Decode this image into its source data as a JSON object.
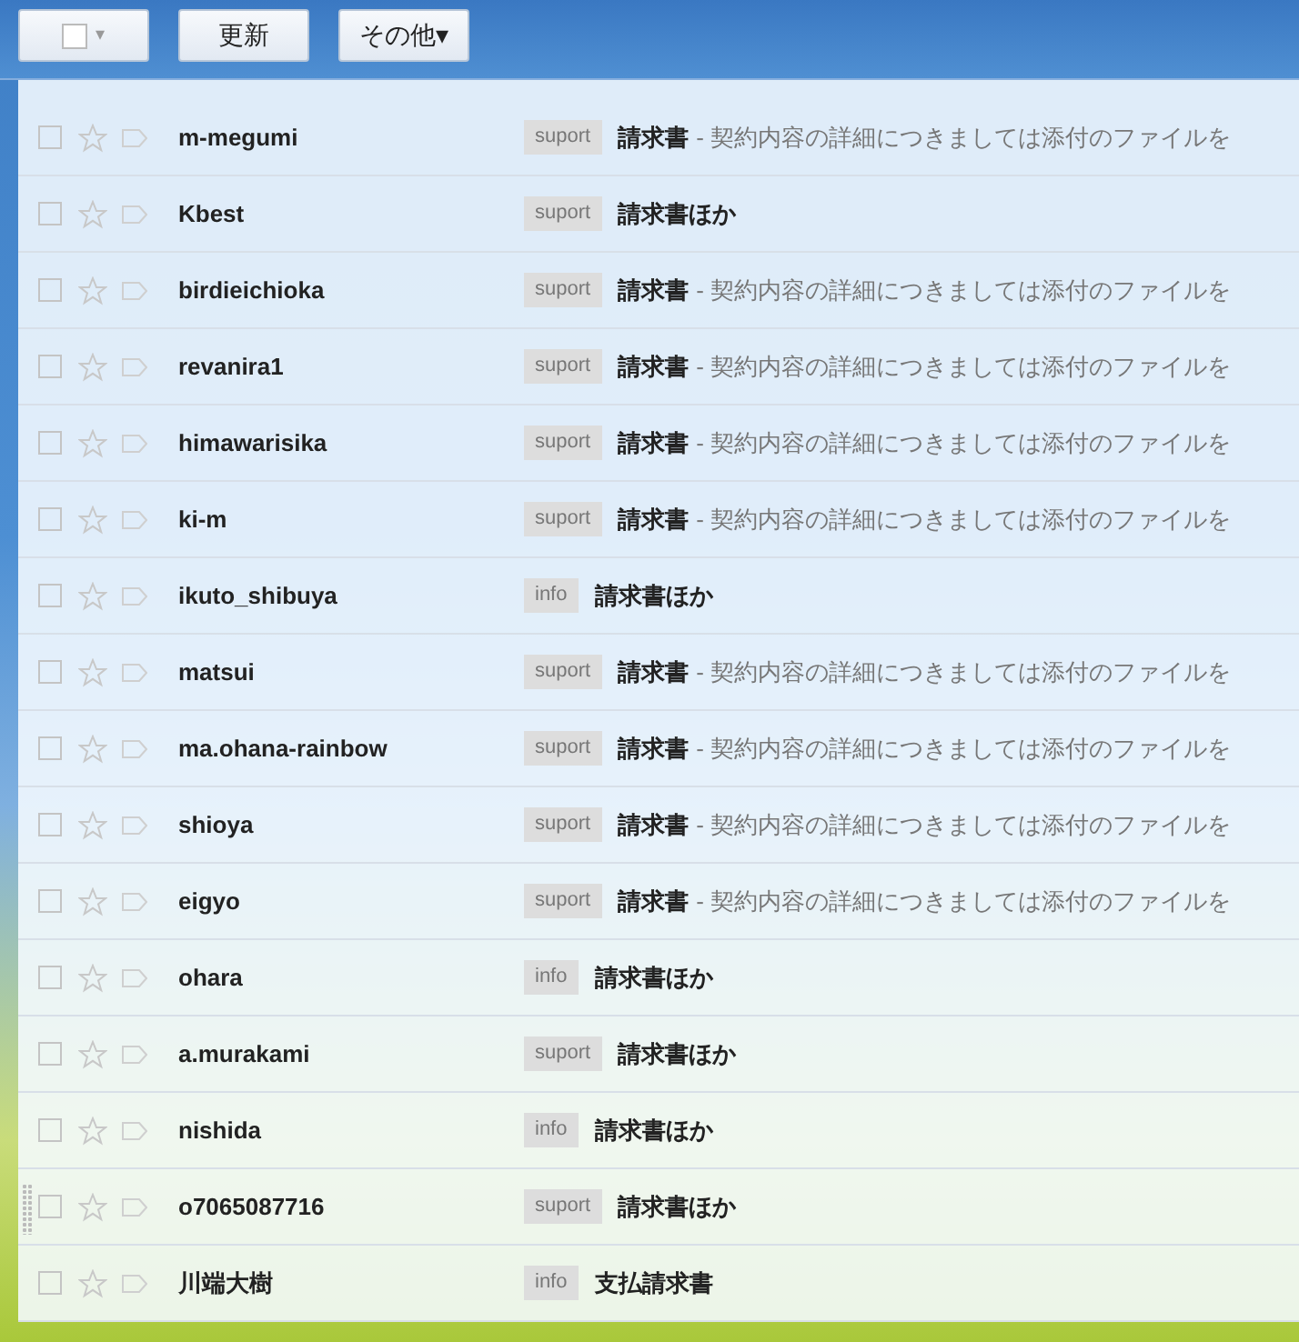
{
  "toolbar": {
    "select_caret": "▾",
    "refresh": "更新",
    "more": "その他",
    "more_caret": "▾"
  },
  "messages": [
    {
      "sender": "m-megumi",
      "tag": "suport",
      "subject": "請求書",
      "snippet": "- 契約内容の詳細につきましては添付のファイルを",
      "checked": false,
      "starred": false
    },
    {
      "sender": "Kbest",
      "tag": "suport",
      "subject": "請求書ほか",
      "checked": false,
      "starred": false
    },
    {
      "sender": "birdieichioka",
      "tag": "suport",
      "subject": "請求書",
      "snippet": "- 契約内容の詳細につきましては添付のファイルを",
      "checked": false,
      "starred": false
    },
    {
      "sender": "revanira1",
      "tag": "suport",
      "subject": "請求書",
      "snippet": "- 契約内容の詳細につきましては添付のファイルを",
      "checked": false,
      "starred": false
    },
    {
      "sender": "himawarisika",
      "tag": "suport",
      "subject": "請求書",
      "snippet": "- 契約内容の詳細につきましては添付のファイルを",
      "checked": false,
      "starred": false
    },
    {
      "sender": "ki-m",
      "tag": "suport",
      "subject": "請求書",
      "snippet": "- 契約内容の詳細につきましては添付のファイルを",
      "checked": false,
      "starred": false
    },
    {
      "sender": "ikuto_shibuya",
      "tag": "info",
      "subject": "請求書ほか",
      "checked": false,
      "starred": false
    },
    {
      "sender": "matsui",
      "tag": "suport",
      "subject": "請求書",
      "snippet": "- 契約内容の詳細につきましては添付のファイルを",
      "checked": false,
      "starred": false
    },
    {
      "sender": "ma.ohana-rainbow",
      "tag": "suport",
      "subject": "請求書",
      "snippet": "- 契約内容の詳細につきましては添付のファイルを",
      "checked": false,
      "starred": false
    },
    {
      "sender": "shioya",
      "tag": "suport",
      "subject": "請求書",
      "snippet": "- 契約内容の詳細につきましては添付のファイルを",
      "checked": false,
      "starred": false
    },
    {
      "sender": "eigyo",
      "tag": "suport",
      "subject": "請求書",
      "snippet": "- 契約内容の詳細につきましては添付のファイルを",
      "checked": false,
      "starred": false
    },
    {
      "sender": "ohara",
      "tag": "info",
      "subject": "請求書ほか",
      "checked": false,
      "starred": false
    },
    {
      "sender": "a.murakami",
      "tag": "suport",
      "subject": "請求書ほか",
      "checked": false,
      "starred": false
    },
    {
      "sender": "nishida",
      "tag": "info",
      "subject": "請求書ほか",
      "checked": false,
      "starred": false
    },
    {
      "sender": "o7065087716",
      "tag": "suport",
      "subject": "請求書ほか",
      "checked": false,
      "starred": false,
      "grip": true
    },
    {
      "sender": "川端大樹",
      "tag": "info",
      "subject": "支払請求書",
      "checked": false,
      "starred": false
    }
  ]
}
